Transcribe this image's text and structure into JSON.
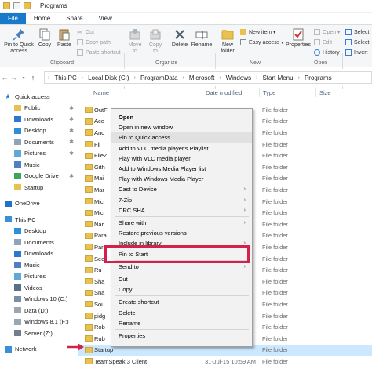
{
  "window": {
    "title": "Programs"
  },
  "ribbon": {
    "tabs": [
      "File",
      "Home",
      "Share",
      "View"
    ],
    "buttons": {
      "pin": "Pin to Quick\naccess",
      "copy": "Copy",
      "paste": "Paste",
      "cut": "Cut",
      "copy_path": "Copy path",
      "paste_shortcut": "Paste shortcut",
      "move_to": "Move\nto",
      "copy_to": "Copy\nto",
      "delete": "Delete",
      "rename": "Rename",
      "new_folder": "New\nfolder",
      "new_item": "New item",
      "easy_access": "Easy access",
      "properties": "Properties",
      "open": "Open",
      "edit": "Edit",
      "history": "History",
      "select_all": "Select",
      "select_none": "Select",
      "invert": "Invert"
    },
    "groups": {
      "clipboard": "Clipboard",
      "organize": "Organize",
      "new": "New",
      "open": "Open"
    }
  },
  "address": {
    "crumbs": [
      "This PC",
      "Local Disk (C:)",
      "ProgramData",
      "Microsoft",
      "Windows",
      "Start Menu",
      "Programs"
    ]
  },
  "columns": {
    "name": "Name",
    "date": "Date modified",
    "type": "Type",
    "size": "Size"
  },
  "nav": [
    {
      "label": "Quick access",
      "icon": "star-icon",
      "color": "#1e73c8",
      "pinned": false,
      "indent": 0
    },
    {
      "label": "Public",
      "icon": "folder-icon",
      "color": "#e9c14f",
      "pinned": true,
      "indent": 1
    },
    {
      "label": "Downloads",
      "icon": "download-icon",
      "color": "#2b78d0",
      "pinned": true,
      "indent": 1
    },
    {
      "label": "Desktop",
      "icon": "desktop-icon",
      "color": "#2b90d9",
      "pinned": true,
      "indent": 1
    },
    {
      "label": "Documents",
      "icon": "documents-icon",
      "color": "#8fa4b8",
      "pinned": true,
      "indent": 1
    },
    {
      "label": "Pictures",
      "icon": "pictures-icon",
      "color": "#5fa8d8",
      "pinned": true,
      "indent": 1
    },
    {
      "label": "Music",
      "icon": "music-icon",
      "color": "#4f7fc4",
      "pinned": false,
      "indent": 1
    },
    {
      "label": "Google Drive",
      "icon": "google-drive-icon",
      "color": "#3ba55c",
      "pinned": true,
      "indent": 1
    },
    {
      "label": "Startup",
      "icon": "folder-icon",
      "color": "#e9c14f",
      "pinned": false,
      "indent": 1
    },
    {
      "label": "OneDrive",
      "icon": "cloud-icon",
      "color": "#1e73c8",
      "pinned": false,
      "indent": 0
    },
    {
      "label": "This PC",
      "icon": "computer-icon",
      "color": "#3a8fd6",
      "pinned": false,
      "indent": 0
    },
    {
      "label": "Desktop",
      "icon": "desktop-icon",
      "color": "#2b90d9",
      "pinned": false,
      "indent": 1
    },
    {
      "label": "Documents",
      "icon": "documents-icon",
      "color": "#8fa4b8",
      "pinned": false,
      "indent": 1
    },
    {
      "label": "Downloads",
      "icon": "download-icon",
      "color": "#2b78d0",
      "pinned": false,
      "indent": 1
    },
    {
      "label": "Music",
      "icon": "music-icon",
      "color": "#4f7fc4",
      "pinned": false,
      "indent": 1
    },
    {
      "label": "Pictures",
      "icon": "pictures-icon",
      "color": "#5fa8d8",
      "pinned": false,
      "indent": 1
    },
    {
      "label": "Videos",
      "icon": "videos-icon",
      "color": "#5a6f8a",
      "pinned": false,
      "indent": 1
    },
    {
      "label": "Windows 10 (C:)",
      "icon": "drive-icon",
      "color": "#7a8ea4",
      "pinned": false,
      "indent": 1
    },
    {
      "label": "Data (D:)",
      "icon": "drive-icon",
      "color": "#9aa6b2",
      "pinned": false,
      "indent": 1
    },
    {
      "label": "Windows 8.1 (F:)",
      "icon": "drive-icon",
      "color": "#9aa6b2",
      "pinned": false,
      "indent": 1
    },
    {
      "label": "Server (Z:)",
      "icon": "network-drive-icon",
      "color": "#6f7f8f",
      "pinned": false,
      "indent": 1
    },
    {
      "label": "Network",
      "icon": "network-icon",
      "color": "#3a8fd6",
      "pinned": false,
      "indent": 0
    }
  ],
  "files": [
    {
      "name": "OutF",
      "date": "",
      "type": "File folder",
      "selected": false
    },
    {
      "name": "Acc",
      "date": "",
      "type": "File folder",
      "selected": false
    },
    {
      "name": "Anc",
      "date": "",
      "type": "File folder",
      "selected": false
    },
    {
      "name": "Fil",
      "date": "",
      "type": "File folder",
      "selected": false
    },
    {
      "name": "FileZ",
      "date": "",
      "type": "File folder",
      "selected": false
    },
    {
      "name": "Gith",
      "date": "",
      "type": "File folder",
      "selected": false
    },
    {
      "name": "Mai",
      "date": "",
      "type": "File folder",
      "selected": false
    },
    {
      "name": "Mar",
      "date": "",
      "type": "File folder",
      "selected": false
    },
    {
      "name": "Mic",
      "date": "",
      "type": "File folder",
      "selected": false
    },
    {
      "name": "Mic",
      "date": "",
      "type": "File folder",
      "selected": false
    },
    {
      "name": "Nar",
      "date": "",
      "type": "File folder",
      "selected": false
    },
    {
      "name": "Para",
      "date": "",
      "type": "File folder",
      "selected": false
    },
    {
      "name": "Para",
      "date": "",
      "type": "File folder",
      "selected": false
    },
    {
      "name": "Sec",
      "date": "",
      "type": "File folder",
      "selected": false
    },
    {
      "name": "Ru",
      "date": "",
      "type": "File folder",
      "selected": false
    },
    {
      "name": "Sha",
      "date": "",
      "type": "File folder",
      "selected": false
    },
    {
      "name": "Sna",
      "date": "",
      "type": "File folder",
      "selected": false
    },
    {
      "name": "Sou",
      "date": "",
      "type": "File folder",
      "selected": false
    },
    {
      "name": "pidg",
      "date": "",
      "type": "File folder",
      "selected": false
    },
    {
      "name": "Rob",
      "date": "",
      "type": "File folder",
      "selected": false
    },
    {
      "name": "Rub",
      "date": "",
      "type": "File folder",
      "selected": false
    },
    {
      "name": "Startup",
      "date": "",
      "type": "File folder",
      "selected": true
    },
    {
      "name": "TeamSpeak 3 Client",
      "date": "31-Jul-15 10:59 AM",
      "type": "File folder",
      "selected": false
    }
  ],
  "context_menu": [
    {
      "label": "Open",
      "bold": true,
      "submenu": false,
      "sep_before": false
    },
    {
      "label": "Open in new window",
      "bold": false,
      "submenu": false,
      "sep_before": false
    },
    {
      "label": "Pin to Quick access",
      "bold": false,
      "submenu": false,
      "sep_before": false,
      "hover": true
    },
    {
      "label": "Add to VLC media player's Playlist",
      "bold": false,
      "submenu": false,
      "sep_before": false
    },
    {
      "label": "Play with VLC media player",
      "bold": false,
      "submenu": false,
      "sep_before": false
    },
    {
      "label": "Add to Windows Media Player list",
      "bold": false,
      "submenu": false,
      "sep_before": false
    },
    {
      "label": "Play with Windows Media Player",
      "bold": false,
      "submenu": false,
      "sep_before": false
    },
    {
      "label": "Cast to Device",
      "bold": false,
      "submenu": true,
      "sep_before": false
    },
    {
      "label": "7-Zip",
      "bold": false,
      "submenu": true,
      "sep_before": false
    },
    {
      "label": "CRC SHA",
      "bold": false,
      "submenu": true,
      "sep_before": false
    },
    {
      "label": "Share with",
      "bold": false,
      "submenu": true,
      "sep_before": true
    },
    {
      "label": "Restore previous versions",
      "bold": false,
      "submenu": false,
      "sep_before": false
    },
    {
      "label": "Include in library",
      "bold": false,
      "submenu": true,
      "sep_before": false
    },
    {
      "label": "Pin to Start",
      "bold": false,
      "submenu": false,
      "sep_before": false
    },
    {
      "label": "Send to",
      "bold": false,
      "submenu": true,
      "sep_before": true
    },
    {
      "label": "Cut",
      "bold": false,
      "submenu": false,
      "sep_before": true
    },
    {
      "label": "Copy",
      "bold": false,
      "submenu": false,
      "sep_before": false
    },
    {
      "label": "Create shortcut",
      "bold": false,
      "submenu": false,
      "sep_before": true
    },
    {
      "label": "Delete",
      "bold": false,
      "submenu": false,
      "sep_before": false
    },
    {
      "label": "Rename",
      "bold": false,
      "submenu": false,
      "sep_before": false
    },
    {
      "label": "Properties",
      "bold": false,
      "submenu": false,
      "sep_before": true
    }
  ],
  "colors": {
    "accent": "#1979ca",
    "highlight_box": "#d3214e",
    "selection": "#cce8ff"
  }
}
